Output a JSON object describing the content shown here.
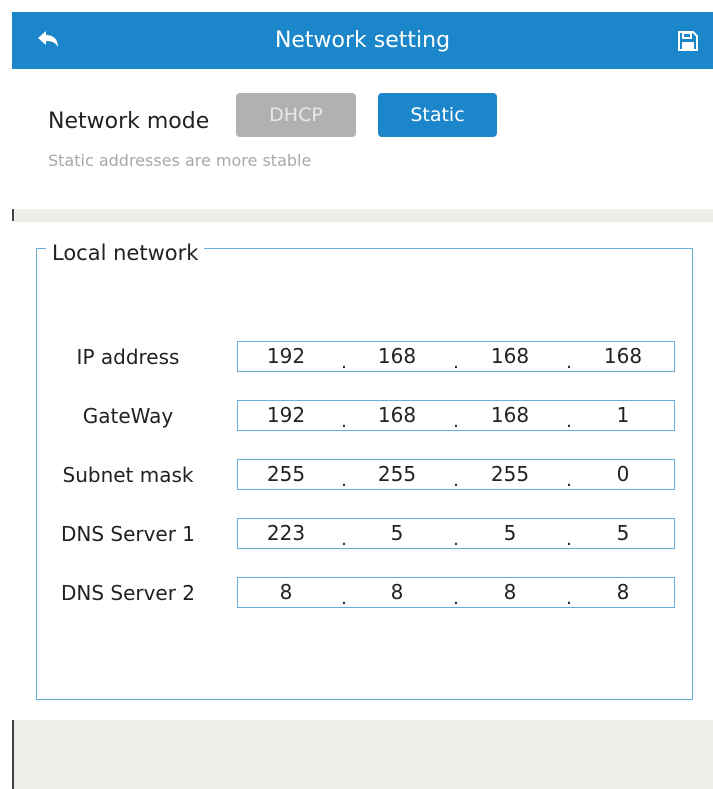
{
  "header": {
    "title": "Network setting",
    "back_icon": "back-arrow-icon",
    "save_icon": "floppy-disk-icon",
    "background": "#1b86c9"
  },
  "network_mode": {
    "label": "Network mode",
    "options": [
      "DHCP",
      "Static"
    ],
    "selected": "Static",
    "hint": "Static addresses are more stable"
  },
  "local_network": {
    "title": "Local network",
    "rows": [
      {
        "label": "IP address",
        "octets": [
          "192",
          "168",
          "168",
          "168"
        ]
      },
      {
        "label": "GateWay",
        "octets": [
          "192",
          "168",
          "168",
          "1"
        ]
      },
      {
        "label": "Subnet mask",
        "octets": [
          "255",
          "255",
          "255",
          "0"
        ]
      },
      {
        "label": "DNS Server 1",
        "octets": [
          "223",
          "5",
          "5",
          "5"
        ]
      },
      {
        "label": "DNS Server 2",
        "octets": [
          "8",
          "8",
          "8",
          "8"
        ]
      }
    ]
  },
  "colors": {
    "accent": "#1b86c9",
    "inactive_button": "#b1b1b1",
    "field_border": "#6aaedb",
    "band": "#efedea"
  }
}
